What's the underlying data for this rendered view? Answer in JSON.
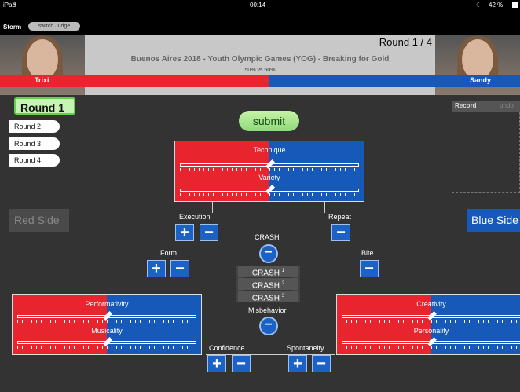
{
  "status": {
    "device": "iPad",
    "time": "00:14",
    "battery": "42 %"
  },
  "topbar": {
    "app_name": "Storm",
    "switch_label": "switch Judge"
  },
  "header": {
    "round_indicator": "Round 1 / 4",
    "event_title": "Buenos Aires 2018 - Youth Olympic Games (YOG) - Breaking for Gold",
    "vs_text": "50% vs 50%",
    "red_name": "Trixi",
    "blue_name": "Sandy",
    "split_fraction": 0.5
  },
  "rounds": [
    "Round 1",
    "Round 2",
    "Round 3",
    "Round 4"
  ],
  "record": {
    "record_label": "Record",
    "undo_label": "undo"
  },
  "submit_label": "submit",
  "sides": {
    "red": "Red Side",
    "blue": "Blue Side"
  },
  "panels": {
    "top": {
      "label1": "Technique",
      "label2": "Variety",
      "value1": 0.5,
      "value2": 0.5
    },
    "left": {
      "label1": "Performativity",
      "label2": "Musicality",
      "value1": 0.5,
      "value2": 0.5
    },
    "right": {
      "label1": "Creativity",
      "label2": "Personality",
      "value1": 0.5,
      "value2": 0.5
    }
  },
  "controls": {
    "execution": "Execution",
    "form": "Form",
    "repeat": "Repeat",
    "bite": "Bite",
    "crash": "CRASH",
    "crash_rows": [
      "CRASH",
      "CRASH",
      "CRASH"
    ],
    "crash_sup": [
      "1",
      "2",
      "3"
    ],
    "misbehavior": "Misbehavior",
    "confidence": "Confidence",
    "spontaneity": "Spontaneity",
    "plus": "+",
    "minus": "−"
  },
  "colors": {
    "red": "#e8252f",
    "blue": "#1659b8",
    "background": "#333333",
    "submit": "#a8e68e"
  }
}
